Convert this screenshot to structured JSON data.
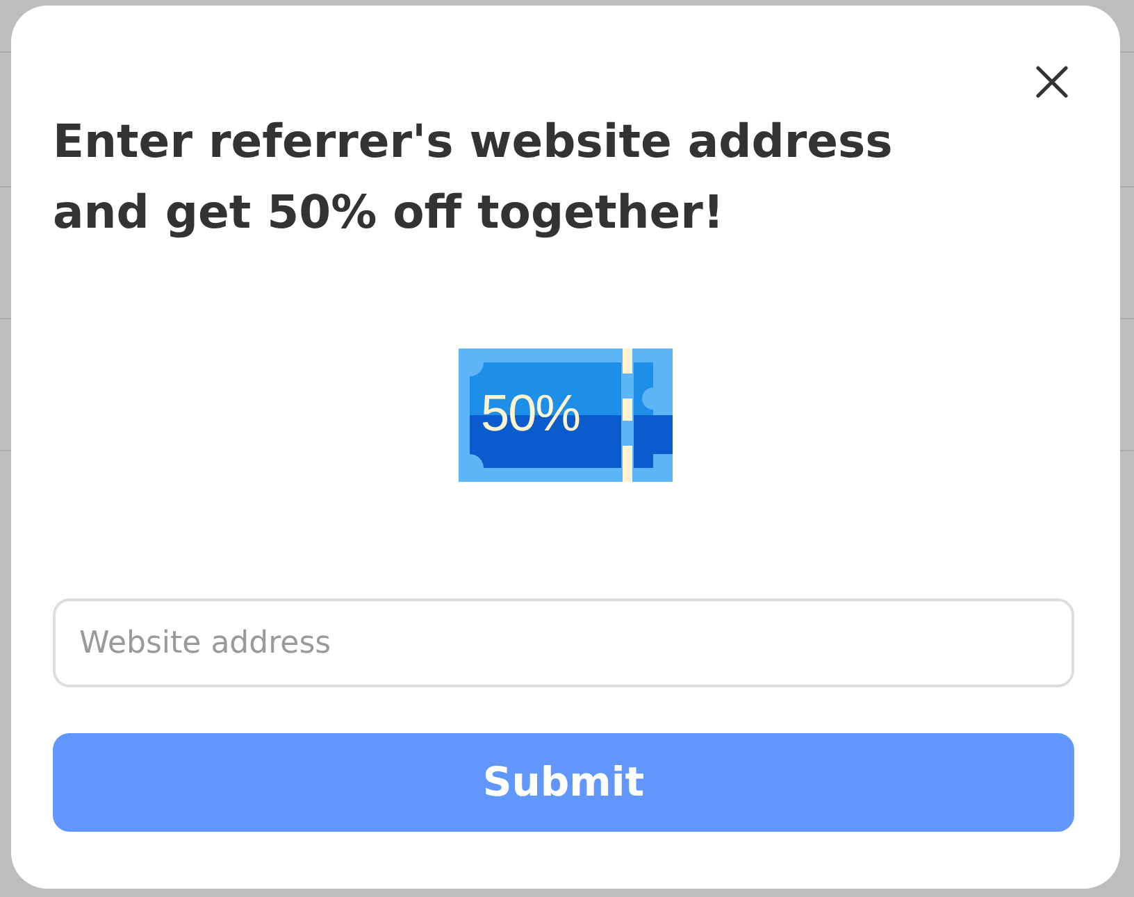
{
  "dialog": {
    "title": "Enter referrer's website address and get 50% off together!",
    "coupon": {
      "label": "50%"
    },
    "field": {
      "placeholder": "Website address"
    },
    "submit": {
      "label": "Submit"
    }
  }
}
